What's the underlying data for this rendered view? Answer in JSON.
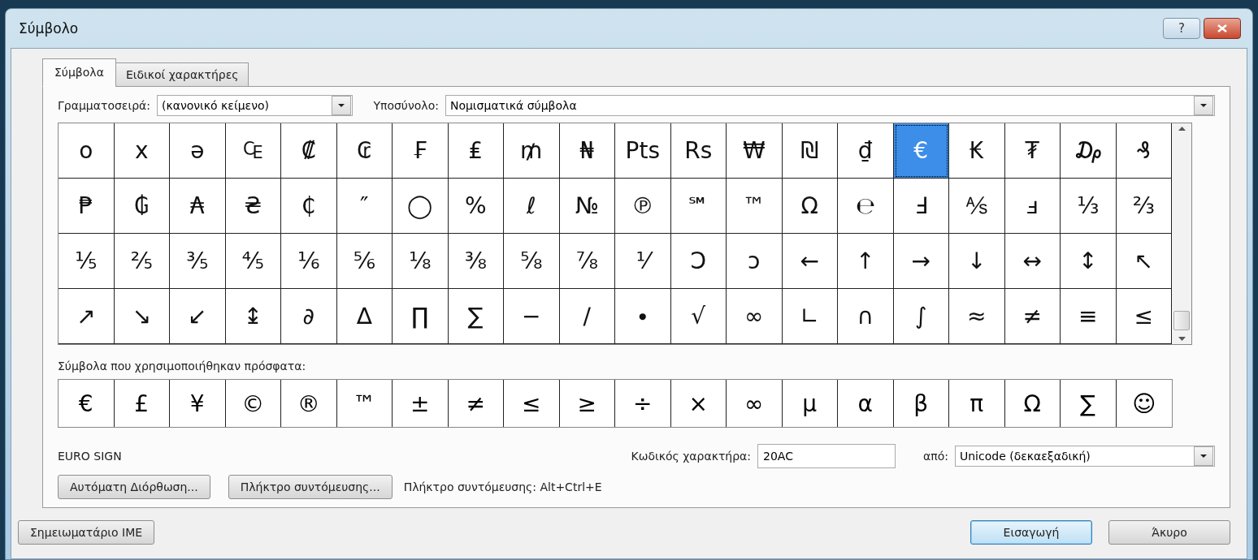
{
  "window": {
    "title": "Σύμβολο",
    "help": "?"
  },
  "tabs": [
    {
      "label": "Σύμβολα",
      "selected": true
    },
    {
      "label": "Ειδικοί χαρακτήρες",
      "selected": false
    }
  ],
  "font": {
    "label": "Γραμματοσειρά:",
    "value": "(κανονικό κείμενο)"
  },
  "subset": {
    "label": "Υποσύνολο:",
    "value": "Νομισματικά σύμβολα"
  },
  "symbol_rows": [
    {
      "cells": [
        {
          "c": "o",
          "selected": false
        },
        {
          "c": "x",
          "selected": false
        },
        {
          "c": "ə",
          "selected": false
        },
        {
          "c": "₠",
          "selected": false
        },
        {
          "c": "₡",
          "selected": false
        },
        {
          "c": "₢",
          "selected": false
        },
        {
          "c": "₣",
          "selected": false
        },
        {
          "c": "₤",
          "selected": false
        },
        {
          "c": "₥",
          "selected": false
        },
        {
          "c": "₦",
          "selected": false
        },
        {
          "c": "Pts",
          "selected": false
        },
        {
          "c": "Rs",
          "selected": false
        },
        {
          "c": "₩",
          "selected": false
        },
        {
          "c": "₪",
          "selected": false
        },
        {
          "c": "₫",
          "selected": false
        },
        {
          "c": "€",
          "selected": true
        },
        {
          "c": "₭",
          "selected": false
        },
        {
          "c": "₮",
          "selected": false
        },
        {
          "c": "₯",
          "selected": false
        },
        {
          "c": "₰",
          "selected": false
        }
      ]
    },
    {
      "cells": [
        {
          "c": "₱",
          "selected": false
        },
        {
          "c": "₲",
          "selected": false
        },
        {
          "c": "₳",
          "selected": false
        },
        {
          "c": "₴",
          "selected": false
        },
        {
          "c": "₵",
          "selected": false
        },
        {
          "c": "″",
          "selected": false
        },
        {
          "c": "◯",
          "selected": false
        },
        {
          "c": "%",
          "selected": false
        },
        {
          "c": "ℓ",
          "selected": false
        },
        {
          "c": "№",
          "selected": false
        },
        {
          "c": "℗",
          "selected": false
        },
        {
          "c": "℠",
          "selected": false
        },
        {
          "c": "™",
          "selected": false
        },
        {
          "c": "Ω",
          "selected": false
        },
        {
          "c": "℮",
          "selected": false
        },
        {
          "c": "Ⅎ",
          "selected": false
        },
        {
          "c": "⅍",
          "selected": false
        },
        {
          "c": "ⅎ",
          "selected": false
        },
        {
          "c": "⅓",
          "selected": false
        },
        {
          "c": "⅔",
          "selected": false
        }
      ]
    },
    {
      "cells": [
        {
          "c": "⅕",
          "selected": false
        },
        {
          "c": "⅖",
          "selected": false
        },
        {
          "c": "⅗",
          "selected": false
        },
        {
          "c": "⅘",
          "selected": false
        },
        {
          "c": "⅙",
          "selected": false
        },
        {
          "c": "⅚",
          "selected": false
        },
        {
          "c": "⅛",
          "selected": false
        },
        {
          "c": "⅜",
          "selected": false
        },
        {
          "c": "⅝",
          "selected": false
        },
        {
          "c": "⅞",
          "selected": false
        },
        {
          "c": "⅟",
          "selected": false
        },
        {
          "c": "Ↄ",
          "selected": false
        },
        {
          "c": "ↄ",
          "selected": false
        },
        {
          "c": "←",
          "selected": false
        },
        {
          "c": "↑",
          "selected": false
        },
        {
          "c": "→",
          "selected": false
        },
        {
          "c": "↓",
          "selected": false
        },
        {
          "c": "↔",
          "selected": false
        },
        {
          "c": "↕",
          "selected": false
        },
        {
          "c": "↖",
          "selected": false
        }
      ]
    },
    {
      "cells": [
        {
          "c": "↗",
          "selected": false
        },
        {
          "c": "↘",
          "selected": false
        },
        {
          "c": "↙",
          "selected": false
        },
        {
          "c": "↨",
          "selected": false
        },
        {
          "c": "∂",
          "selected": false
        },
        {
          "c": "∆",
          "selected": false
        },
        {
          "c": "∏",
          "selected": false
        },
        {
          "c": "∑",
          "selected": false
        },
        {
          "c": "−",
          "selected": false
        },
        {
          "c": "∕",
          "selected": false
        },
        {
          "c": "∙",
          "selected": false
        },
        {
          "c": "√",
          "selected": false
        },
        {
          "c": "∞",
          "selected": false
        },
        {
          "c": "∟",
          "selected": false
        },
        {
          "c": "∩",
          "selected": false
        },
        {
          "c": "∫",
          "selected": false
        },
        {
          "c": "≈",
          "selected": false
        },
        {
          "c": "≠",
          "selected": false
        },
        {
          "c": "≡",
          "selected": false
        },
        {
          "c": "≤",
          "selected": false
        }
      ]
    }
  ],
  "recent": {
    "label": "Σύμβολα που χρησιμοποιήθηκαν πρόσφατα:",
    "symbols": [
      "€",
      "£",
      "¥",
      "©",
      "®",
      "™",
      "±",
      "≠",
      "≤",
      "≥",
      "÷",
      "×",
      "∞",
      "µ",
      "α",
      "β",
      "π",
      "Ω",
      "∑",
      "☺"
    ]
  },
  "character_name": "EURO SIGN",
  "char_code": {
    "label": "Κωδικός χαρακτήρα:",
    "value": "20AC"
  },
  "from": {
    "label": "από:",
    "value": "Unicode (δεκαεξαδική)"
  },
  "autocorrect_button": "Αυτόματη Διόρθωση...",
  "shortcut_button": "Πλήκτρο συντόμευσης...",
  "shortcut_text": "Πλήκτρο συντόμευσης: Alt+Ctrl+E",
  "ime_button": "Σημειωματάριο IME",
  "footer_buttons": [
    {
      "label": "Εισαγωγή",
      "default": true
    },
    {
      "label": "Άκυρο",
      "default": false
    }
  ]
}
